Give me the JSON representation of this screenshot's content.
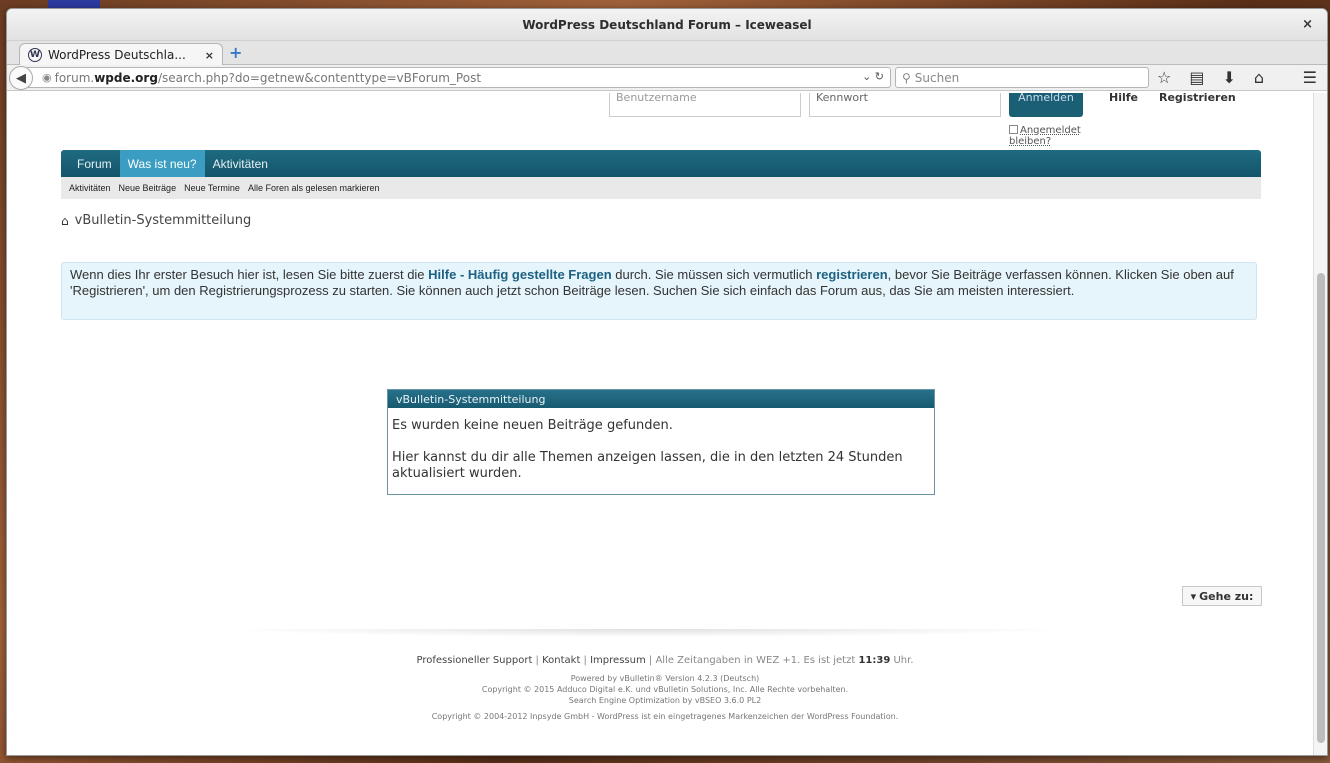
{
  "window": {
    "title": "WordPress Deutschland Forum – Iceweasel",
    "close_glyph": "×"
  },
  "tabs": [
    {
      "label": "WordPress Deutschla...",
      "close_glyph": "×"
    }
  ],
  "newtab_glyph": "+",
  "navbar": {
    "url_prefix": "forum.",
    "url_domain": "wpde.org",
    "url_path": "/search.php?do=getnew&contenttype=vBForum_Post",
    "search_placeholder": "Suchen"
  },
  "login": {
    "username_placeholder": "Benutzername",
    "password_placeholder": "Kennwort",
    "login_button": "Anmelden",
    "help_link": "Hilfe",
    "register_link": "Registrieren",
    "remember_label": "Angemeldet bleiben?"
  },
  "forum_nav": {
    "items": [
      {
        "label": "Forum"
      },
      {
        "label": "Was ist neu?"
      },
      {
        "label": "Aktivitäten"
      }
    ]
  },
  "subnav": {
    "items": [
      {
        "label": "Aktivitäten"
      },
      {
        "label": "Neue Beiträge"
      },
      {
        "label": "Neue Termine"
      },
      {
        "label": "Alle Foren als gelesen markieren"
      }
    ]
  },
  "breadcrumb": {
    "current": "vBulletin-Systemmitteilung"
  },
  "notice": {
    "part1": "Wenn dies Ihr erster Besuch hier ist, lesen Sie bitte zuerst die ",
    "faq_link": "Hilfe - Häufig gestellte Fragen",
    "part2": " durch. Sie müssen sich vermutlich ",
    "register_link": "registrieren",
    "part3": ", bevor Sie Beiträge verfassen können. Klicken Sie oben auf 'Registrieren', um den Registrierungsprozess zu starten. Sie können auch jetzt schon Beiträge lesen. Suchen Sie sich einfach das Forum aus, das Sie am meisten interessiert."
  },
  "system_message": {
    "header": "vBulletin-Systemmitteilung",
    "line1": "Es wurden keine neuen Beiträge gefunden.",
    "line2": "Hier kannst du dir alle Themen anzeigen lassen, die in den letzten 24 Stunden aktualisiert wurden."
  },
  "goto": {
    "label": "Gehe zu:"
  },
  "footer": {
    "support": "Professioneller Support",
    "contact": "Kontakt",
    "imprint": "Impressum",
    "time_prefix": "Alle Zeitangaben in WEZ +1. Es ist jetzt ",
    "time": "11:39",
    "time_suffix": " Uhr.",
    "powered1": "Powered by vBulletin® Version 4.2.3 (Deutsch)",
    "powered2": "Copyright © 2015 Adduco Digital e.K. und vBulletin Solutions, Inc. Alle Rechte vorbehalten.",
    "powered3": "Search Engine Optimization by vBSEO 3.6.0 PL2",
    "copyright": "Copyright © 2004-2012 Inpsyde GmbH - WordPress ist ein eingetragenes Markenzeichen der WordPress Foundation."
  }
}
